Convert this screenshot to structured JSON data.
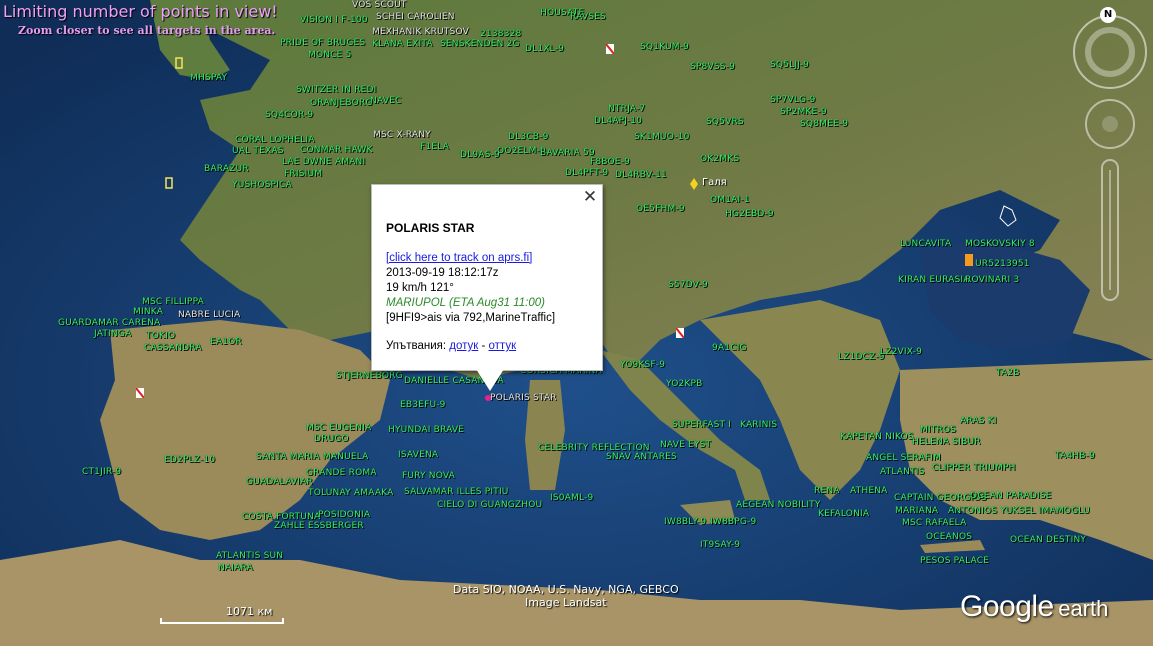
{
  "warning": {
    "title": "Limiting number of points in view!",
    "subtitle": "Zoom closer to see all targets in the area."
  },
  "popup": {
    "title": "POLARIS STAR",
    "track_link": "[click here to track on aprs.fi]",
    "timestamp": "2013-09-19 18:12:17z",
    "speed_course": "19 km/h 121°",
    "destination": "MARIUPOL (ETA Aug31 11:00)",
    "path": "[9HFI9>ais via 792,MarineTraffic]",
    "directions_label": "Упътвания:",
    "to_here": "дотук",
    "separator": " - ",
    "from_here": "оттук",
    "close": "✕"
  },
  "places": {
    "galati": "Галя"
  },
  "vessels": [
    {
      "name": "VOS SCOUT"
    },
    {
      "name": "SCHEI CAROLIEN"
    },
    {
      "name": "VISION I F-100"
    },
    {
      "name": "MEXHANIK KRUTSOV"
    },
    {
      "name": "PRIDE OF BRUGES"
    },
    {
      "name": "KLANA EXITA"
    },
    {
      "name": "MONCE 5"
    },
    {
      "name": "SENSKENDEN 2G"
    },
    {
      "name": "DL1XL-9"
    },
    {
      "name": "2138328"
    },
    {
      "name": "HOUSATE"
    },
    {
      "name": "RAVSES"
    },
    {
      "name": "SQ1KUM-9"
    },
    {
      "name": "SQ5LJJ-9"
    },
    {
      "name": "SP8VSS-9"
    },
    {
      "name": "MHSPAY"
    },
    {
      "name": "SWITZER IN REDI"
    },
    {
      "name": "ORANJEBORG"
    },
    {
      "name": "NAVEC"
    },
    {
      "name": "SQ4COR-9"
    },
    {
      "name": "CORAL LOPHELIA"
    },
    {
      "name": "UAL TEXAS"
    },
    {
      "name": "CONMAR HAWK"
    },
    {
      "name": "LAE DWNE AMANI"
    },
    {
      "name": "FRISIUM"
    },
    {
      "name": "BARAZUR"
    },
    {
      "name": "YUSHOSPICA"
    },
    {
      "name": "MSC X-RANY"
    },
    {
      "name": "F1ELA"
    },
    {
      "name": "DL9AS-9"
    },
    {
      "name": "OO2ELM-9"
    },
    {
      "name": "DL3CB-9"
    },
    {
      "name": "BAVARIA 59"
    },
    {
      "name": "F8BOE-9"
    },
    {
      "name": "DL4PFT-9"
    },
    {
      "name": "DL4RBV-11"
    },
    {
      "name": "OK2MKS"
    },
    {
      "name": "OM1AI-1"
    },
    {
      "name": "HG2EBD-9"
    },
    {
      "name": "OE5FHM-9"
    },
    {
      "name": "NTRJA-7"
    },
    {
      "name": "DL4APJ-10"
    },
    {
      "name": "SK1MUO-10"
    },
    {
      "name": "SQ5VRS"
    },
    {
      "name": "SP7VLG-9"
    },
    {
      "name": "SP2MKE-9"
    },
    {
      "name": "SQ8MEE-9"
    },
    {
      "name": "LUNCAVITA"
    },
    {
      "name": "MOSKOVSKIY 8"
    },
    {
      "name": "UR5213951"
    },
    {
      "name": "KIRAN EURASIA"
    },
    {
      "name": "ROVINARI 3"
    },
    {
      "name": "MSC FILLIPPA"
    },
    {
      "name": "MINKA"
    },
    {
      "name": "NABRE LUCIA"
    },
    {
      "name": "GUARDAMAR CARENA"
    },
    {
      "name": "JATINGA"
    },
    {
      "name": "TOKIO"
    },
    {
      "name": "CASSANDRA"
    },
    {
      "name": "EA1OR"
    },
    {
      "name": "STJERNEBORG"
    },
    {
      "name": "DANIELLE CASANOVA"
    },
    {
      "name": "CORSICA MARINA"
    },
    {
      "name": "POLARIS STAR"
    },
    {
      "name": "EB3EFU-9"
    },
    {
      "name": "MSC EUGENIA"
    },
    {
      "name": "DRUGO"
    },
    {
      "name": "HYUNDAI BRAVE"
    },
    {
      "name": "SANTA MARIA MANUELA"
    },
    {
      "name": "ISAVENA"
    },
    {
      "name": "GRANDE ROMA"
    },
    {
      "name": "FURY NOVA"
    },
    {
      "name": "GUADALAVIAR"
    },
    {
      "name": "TOLUNAY AMAAKA"
    },
    {
      "name": "SALVAMAR ILLES PITIU"
    },
    {
      "name": "CIELO DI GUANGZHOU"
    },
    {
      "name": "COSTA FORTUNA"
    },
    {
      "name": "POSIDONIA"
    },
    {
      "name": "ZAHLE ESSBERGER"
    },
    {
      "name": "ATLANTIS SUN"
    },
    {
      "name": "NAIARA"
    },
    {
      "name": "CT1JIR-9"
    },
    {
      "name": "ED2PLZ-10"
    },
    {
      "name": "CELEBRITY REFLECTION"
    },
    {
      "name": "SNAV ANTARES"
    },
    {
      "name": "NAVE EYST"
    },
    {
      "name": "SUPERFAST I"
    },
    {
      "name": "KARINIS"
    },
    {
      "name": "AEGEAN NOBILITY"
    },
    {
      "name": "IW8BPG-9"
    },
    {
      "name": "IW8BLY-9"
    },
    {
      "name": "IT9SAY-9"
    },
    {
      "name": "IS0AML-9"
    },
    {
      "name": "KAPETAN NIKOS"
    },
    {
      "name": "HELENA SIBUR"
    },
    {
      "name": "ANGEL SERAFIM"
    },
    {
      "name": "ATLANTIS"
    },
    {
      "name": "RENA"
    },
    {
      "name": "ATHENA"
    },
    {
      "name": "CAPTAIN GEORGIOS"
    },
    {
      "name": "MARIANA"
    },
    {
      "name": "ANTONIOS"
    },
    {
      "name": "YUKSEL IMAMOGLU"
    },
    {
      "name": "MSC RAFAELA"
    },
    {
      "name": "OCEANOS"
    },
    {
      "name": "OCEAN DESTINY"
    },
    {
      "name": "KEFALONIA"
    },
    {
      "name": "PESOS PALACE"
    },
    {
      "name": "CLIPPER TRIUMPH"
    },
    {
      "name": "OCEAN PARADISE"
    },
    {
      "name": "MITROS"
    },
    {
      "name": "TA4HB-9"
    },
    {
      "name": "TA2B"
    },
    {
      "name": "LZ1DCZ-9"
    },
    {
      "name": "LZ2VIX-9"
    },
    {
      "name": "ARAS KI"
    },
    {
      "name": "9A1CIG"
    },
    {
      "name": "S57DV-9"
    },
    {
      "name": "YO2KPB"
    },
    {
      "name": "YO9KSF-9"
    }
  ],
  "attribution": {
    "line1": "Data SIO, NOAA, U.S. Navy, NGA, GEBCO",
    "line2": "Image Landsat"
  },
  "scale": "1071 км",
  "logo": {
    "google": "Google",
    "earth": "earth"
  }
}
